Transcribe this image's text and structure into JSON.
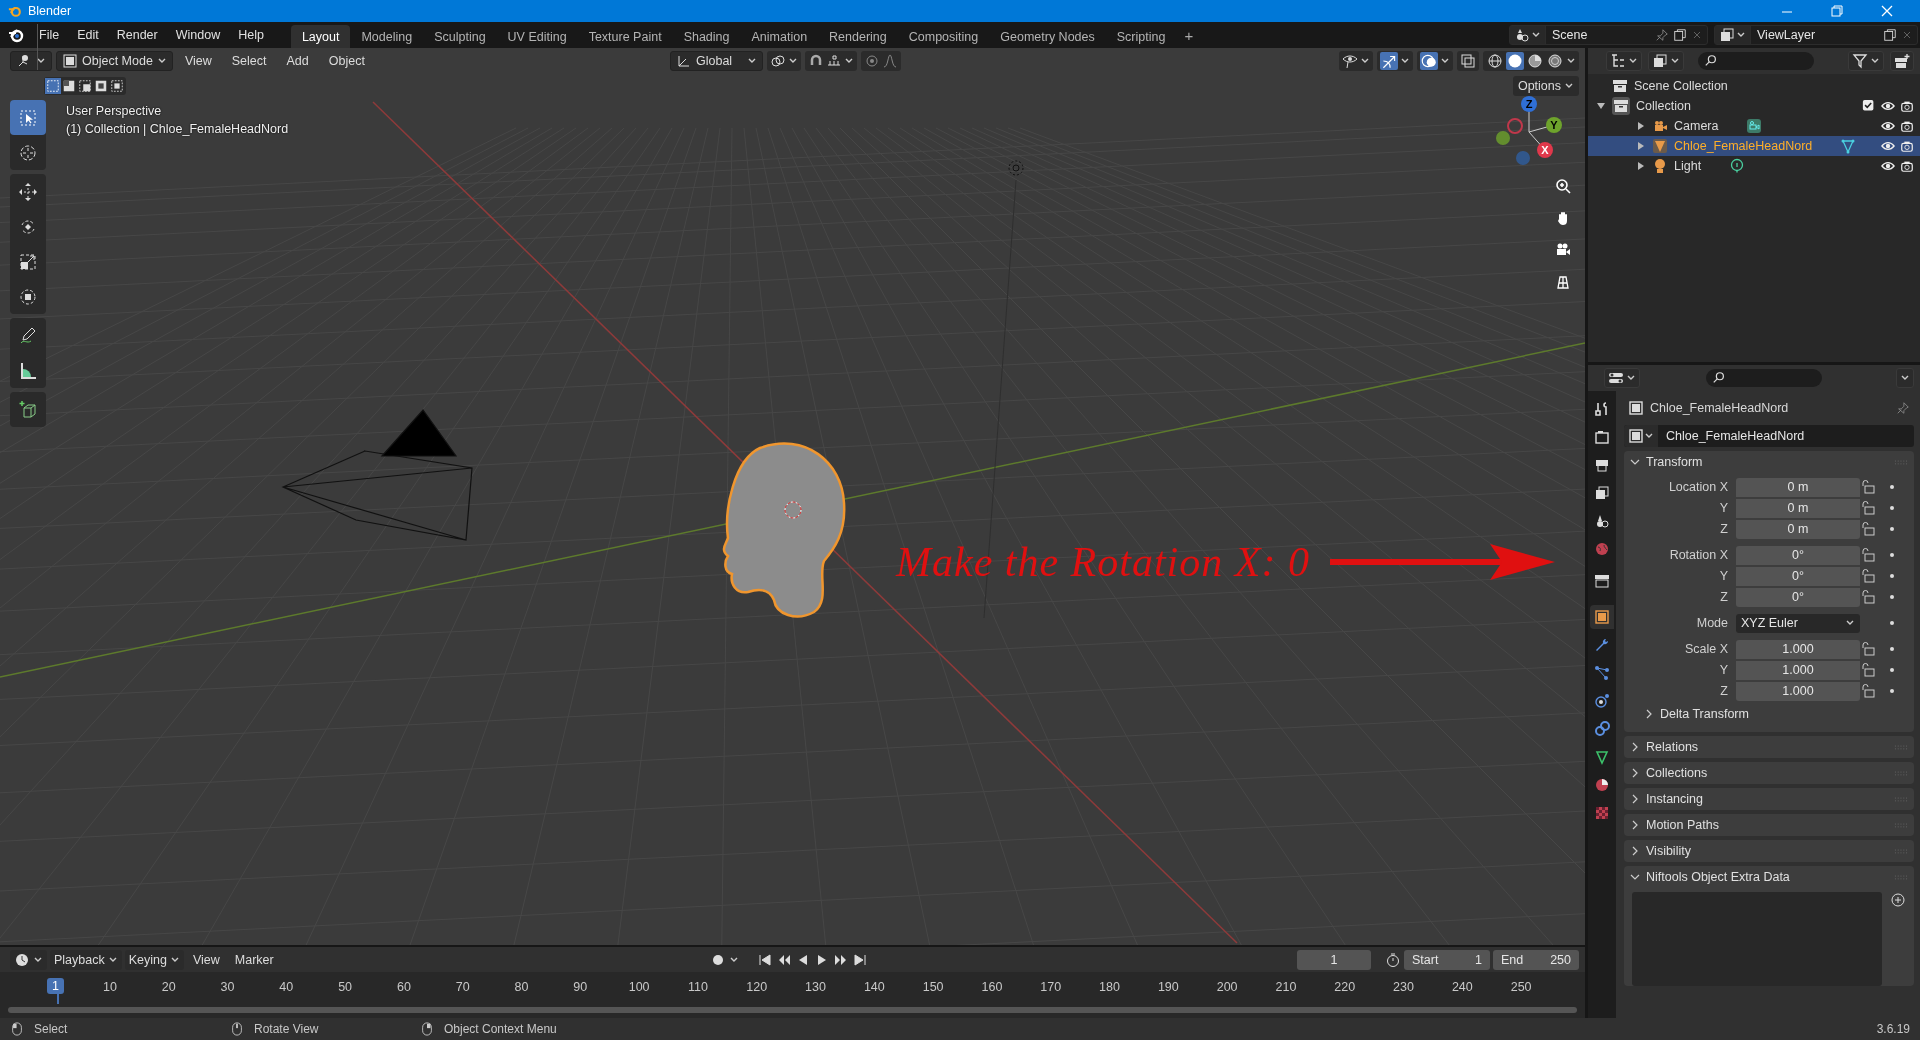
{
  "window": {
    "title": "Blender"
  },
  "menu": [
    "File",
    "Edit",
    "Render",
    "Window",
    "Help"
  ],
  "workspaces": [
    {
      "label": "Layout",
      "selected": true
    },
    {
      "label": "Modeling",
      "selected": false
    },
    {
      "label": "Sculpting",
      "selected": false
    },
    {
      "label": "UV Editing",
      "selected": false
    },
    {
      "label": "Texture Paint",
      "selected": false
    },
    {
      "label": "Shading",
      "selected": false
    },
    {
      "label": "Animation",
      "selected": false
    },
    {
      "label": "Rendering",
      "selected": false
    },
    {
      "label": "Compositing",
      "selected": false
    },
    {
      "label": "Geometry Nodes",
      "selected": false
    },
    {
      "label": "Scripting",
      "selected": false
    }
  ],
  "add_workspace": "+",
  "scene": {
    "name": "Scene"
  },
  "view_layer": {
    "name": "ViewLayer"
  },
  "viewport": {
    "mode": "Object Mode",
    "menus": [
      "View",
      "Select",
      "Add",
      "Object"
    ],
    "orientation": "Global",
    "gizmos_on": true,
    "overlays_on": true,
    "shading": [
      {
        "selected": false
      },
      {
        "selected": true
      },
      {
        "selected": false
      },
      {
        "selected": false
      }
    ],
    "select_modes": [
      {
        "selected": true
      },
      {
        "selected": false
      },
      {
        "selected": false
      },
      {
        "selected": false
      },
      {
        "selected": false
      }
    ],
    "options": "Options",
    "info": [
      "User Perspective",
      "(1) Collection | Chloe_FemaleHeadNord"
    ],
    "tools": [
      {
        "selected": true
      },
      {
        "selected": false
      },
      {
        "selected": false
      },
      {
        "selected": false
      },
      {
        "selected": false
      },
      {
        "selected": false
      },
      {
        "selected": false
      },
      {
        "selected": false
      },
      {
        "selected": false
      }
    ],
    "axes": {
      "x": "X",
      "y": "Y",
      "z": "Z"
    }
  },
  "annotation": {
    "text": "Make the Rotation X: 0"
  },
  "outliner": {
    "root": "Scene Collection",
    "collection": {
      "label": "Collection",
      "expanded": true,
      "checked": true,
      "children": [
        {
          "label": "Camera",
          "kind": "camera",
          "selected": false,
          "expanded": false
        },
        {
          "label": "Chloe_FemaleHeadNord",
          "kind": "mesh",
          "selected": true,
          "expanded": false
        },
        {
          "label": "Light",
          "kind": "light",
          "selected": false,
          "expanded": false
        }
      ]
    }
  },
  "properties": {
    "tabs": [
      {
        "selected": false
      },
      {
        "selected": false
      },
      {
        "selected": false
      },
      {
        "selected": false
      },
      {
        "selected": false
      },
      {
        "selected": false
      },
      {
        "selected": false
      },
      {
        "selected": true
      },
      {
        "selected": false
      },
      {
        "selected": false
      },
      {
        "selected": false
      },
      {
        "selected": false
      },
      {
        "selected": false
      },
      {
        "selected": false
      },
      {
        "selected": false
      }
    ],
    "object_name": "Chloe_FemaleHeadNord",
    "datablock": "Chloe_FemaleHeadNord",
    "transform": {
      "title": "Transform",
      "expanded": true,
      "rows": [
        {
          "label": "Location X",
          "value": "0 m",
          "kind": "number"
        },
        {
          "label": "Y",
          "value": "0 m",
          "kind": "number"
        },
        {
          "label": "Z",
          "value": "0 m",
          "kind": "number"
        },
        {
          "label": "Rotation X",
          "value": "0°",
          "kind": "number"
        },
        {
          "label": "Y",
          "value": "0°",
          "kind": "number"
        },
        {
          "label": "Z",
          "value": "0°",
          "kind": "number"
        },
        {
          "label": "Mode",
          "value": "XYZ Euler",
          "kind": "dropdown"
        },
        {
          "label": "Scale X",
          "value": "1.000",
          "kind": "number"
        },
        {
          "label": "Y",
          "value": "1.000",
          "kind": "number"
        },
        {
          "label": "Z",
          "value": "1.000",
          "kind": "number"
        }
      ],
      "subpanel": {
        "title": "Delta Transform",
        "expanded": false
      }
    },
    "panels": [
      {
        "title": "Relations",
        "expanded": false
      },
      {
        "title": "Collections",
        "expanded": false
      },
      {
        "title": "Instancing",
        "expanded": false
      },
      {
        "title": "Motion Paths",
        "expanded": false
      },
      {
        "title": "Visibility",
        "expanded": false
      },
      {
        "title": "Niftools Object Extra Data",
        "expanded": true
      }
    ]
  },
  "timeline": {
    "menus": [
      "Playback",
      "Keying",
      "View",
      "Marker"
    ],
    "current_frame": "1",
    "start": {
      "label": "Start",
      "value": "1"
    },
    "end": {
      "label": "End",
      "value": "250"
    },
    "ruler_current": "1",
    "ticks": [
      "10",
      "20",
      "30",
      "40",
      "50",
      "60",
      "70",
      "80",
      "90",
      "100",
      "110",
      "120",
      "130",
      "140",
      "150",
      "160",
      "170",
      "180",
      "190",
      "200",
      "210",
      "220",
      "230",
      "240",
      "250"
    ]
  },
  "status_bar": {
    "items": [
      "Select",
      "Rotate View",
      "Object Context Menu"
    ],
    "version": "3.6.19"
  }
}
